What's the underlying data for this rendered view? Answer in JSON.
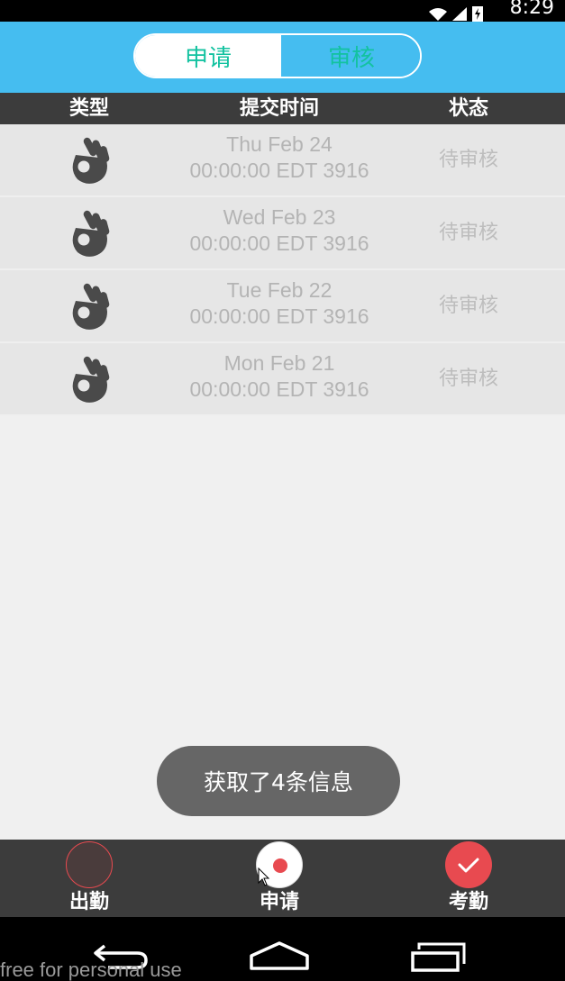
{
  "status_bar": {
    "time": "8:29",
    "icons": [
      "wifi-icon",
      "signal-icon",
      "battery-icon"
    ]
  },
  "header": {
    "segments": [
      {
        "label": "申请",
        "selected": true
      },
      {
        "label": "审核",
        "selected": false
      }
    ]
  },
  "table": {
    "columns": [
      "类型",
      "提交时间",
      "状态"
    ],
    "rows": [
      {
        "icon": "ok-hand-icon",
        "time_line1": "Thu Feb 24",
        "time_line2": "00:00:00 EDT 3916",
        "status": "待审核"
      },
      {
        "icon": "ok-hand-icon",
        "time_line1": "Wed Feb 23",
        "time_line2": "00:00:00 EDT 3916",
        "status": "待审核"
      },
      {
        "icon": "ok-hand-icon",
        "time_line1": "Tue Feb 22",
        "time_line2": "00:00:00 EDT 3916",
        "status": "待审核"
      },
      {
        "icon": "ok-hand-icon",
        "time_line1": "Mon Feb 21",
        "time_line2": "00:00:00 EDT 3916",
        "status": "待审核"
      }
    ]
  },
  "toast": {
    "message": "获取了4条信息"
  },
  "bottom_nav": {
    "items": [
      {
        "label": "出勤",
        "icon": "attendance-circle-icon"
      },
      {
        "label": "申请",
        "icon": "apply-record-icon",
        "selected": true
      },
      {
        "label": "考勤",
        "icon": "check-icon"
      }
    ]
  },
  "system_nav": {
    "icons": [
      "back-icon",
      "home-icon",
      "recent-apps-icon"
    ]
  },
  "watermark": "free for personal use",
  "colors": {
    "header_bg": "#45bdf0",
    "accent_green": "#13c2a0",
    "dark_bar": "#3c3c3c",
    "red": "#e84a50"
  }
}
